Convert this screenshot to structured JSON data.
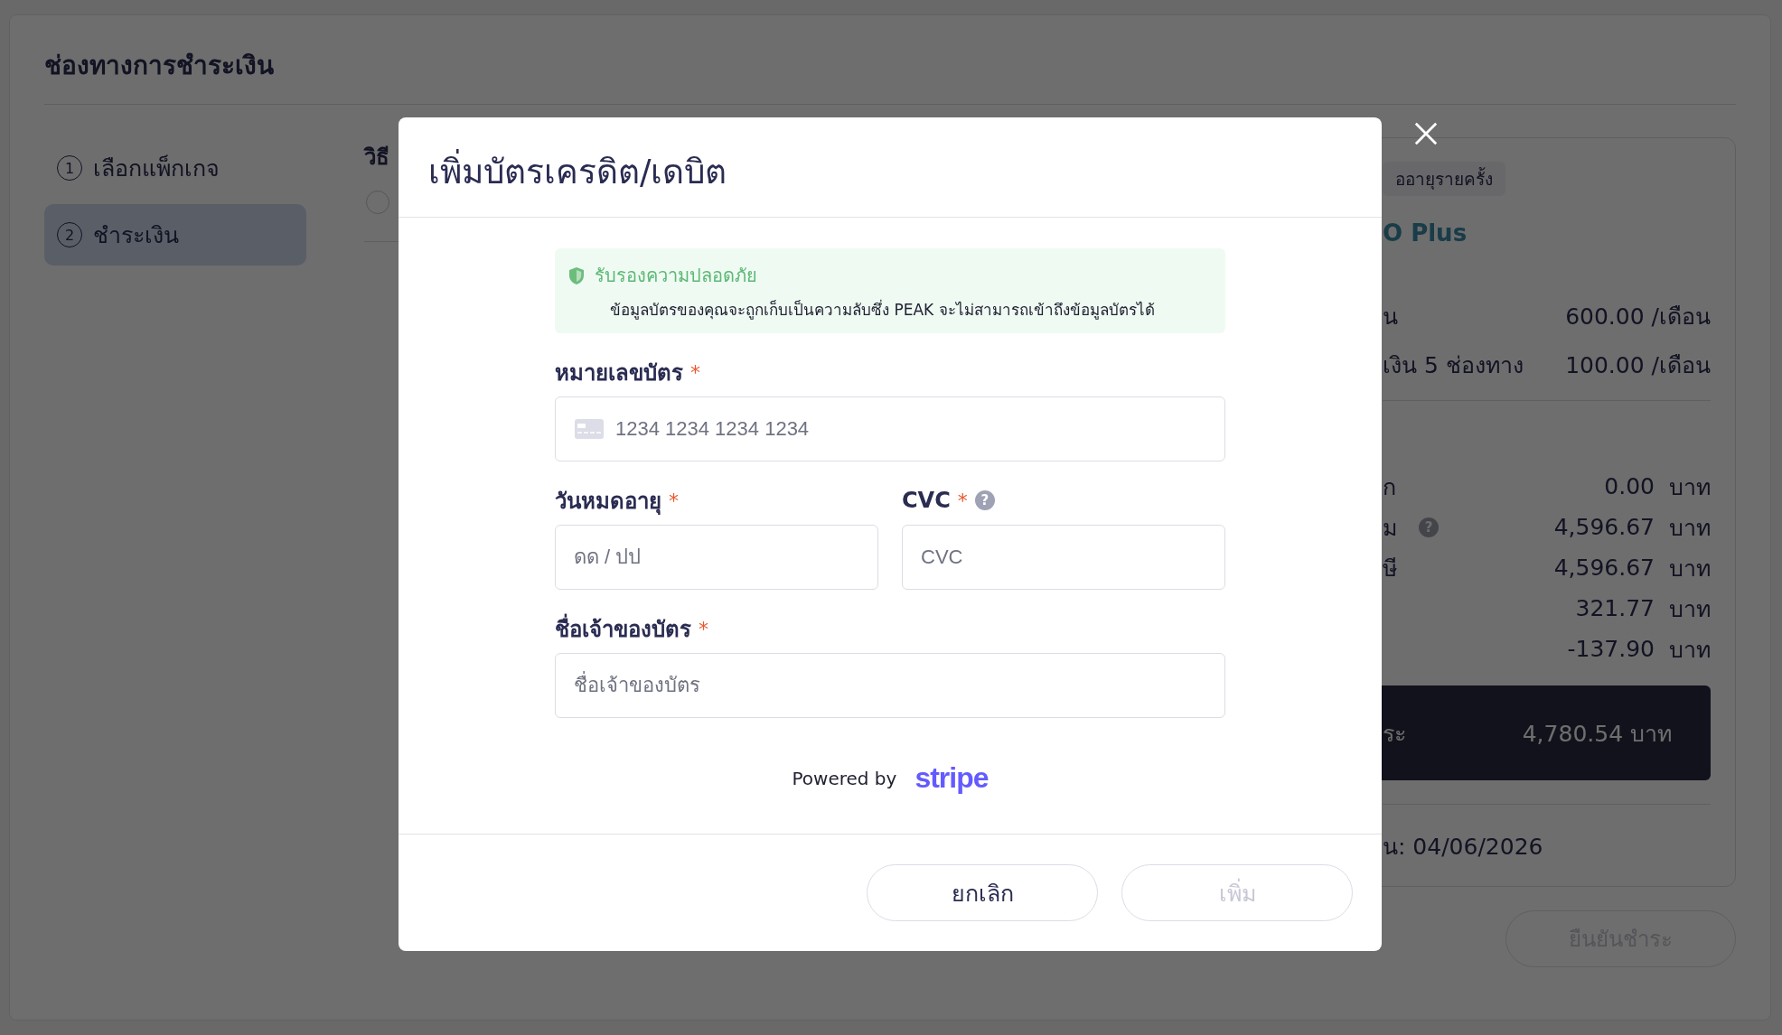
{
  "page": {
    "title": "ช่องทางการชำระเงิน"
  },
  "steps": [
    {
      "number": "1",
      "label": "เลือกแพ็กเกจ",
      "selected": false
    },
    {
      "number": "2",
      "label": "ชำระเงิน",
      "selected": true
    }
  ],
  "payment_method": {
    "heading": "วิธี",
    "selected": false
  },
  "summary": {
    "tag": "ออายุรายครั้ง",
    "plan": "O Plus",
    "monthly_items": [
      {
        "label": "น",
        "amount": "600.00 /เดือน"
      },
      {
        "label": "เงิน 5 ช่องทาง",
        "amount": "100.00 /เดือน"
      }
    ],
    "lines": [
      {
        "label": "ก",
        "value": "0.00",
        "unit": "บาท"
      },
      {
        "label": "ม",
        "help_icon": "?",
        "value": "4,596.67",
        "unit": "บาท"
      },
      {
        "label": "ษี",
        "value": "4,596.67",
        "unit": "บาท"
      },
      {
        "value": "321.77",
        "unit": "บาท"
      },
      {
        "value": "-137.90",
        "unit": "บาท"
      }
    ],
    "total": {
      "label": "ระ",
      "amount": "4,780.54 บาท"
    },
    "date": "น: 04/06/2026",
    "confirm_button": {
      "label": "ยืนยันชำระ",
      "disabled": true
    }
  },
  "modal": {
    "title": "เพิ่มบัตรเครดิต/เดบิต",
    "security_notice": {
      "title": "รับรองความปลอดภัย",
      "text": "ข้อมูลบัตรของคุณจะถูกเก็บเป็นความลับซึ่ง PEAK จะไม่สามารถเข้าถึงข้อมูลบัตรได้"
    },
    "fields": [
      {
        "kind": "card",
        "label": "หมายเลขบัตร",
        "required_mark": "*",
        "placeholder": "1234 1234 1234 1234"
      },
      {
        "kind": "half",
        "label": "วันหมดอายุ",
        "required_mark": "*",
        "placeholder": "ดด / ปป"
      },
      {
        "kind": "half",
        "label": "CVC",
        "required_mark": "*",
        "help_icon": "?",
        "placeholder": "CVC"
      },
      {
        "kind": "full",
        "label": "ชื่อเจ้าของบัตร",
        "required_mark": "*",
        "placeholder": "ชื่อเจ้าของบัตร"
      }
    ],
    "powered_by": {
      "text": "Powered by",
      "brand": "stripe"
    },
    "buttons": [
      {
        "label": "ยกเลิก",
        "disabled": false
      },
      {
        "label": "เพิ่ม",
        "disabled": true
      }
    ]
  }
}
